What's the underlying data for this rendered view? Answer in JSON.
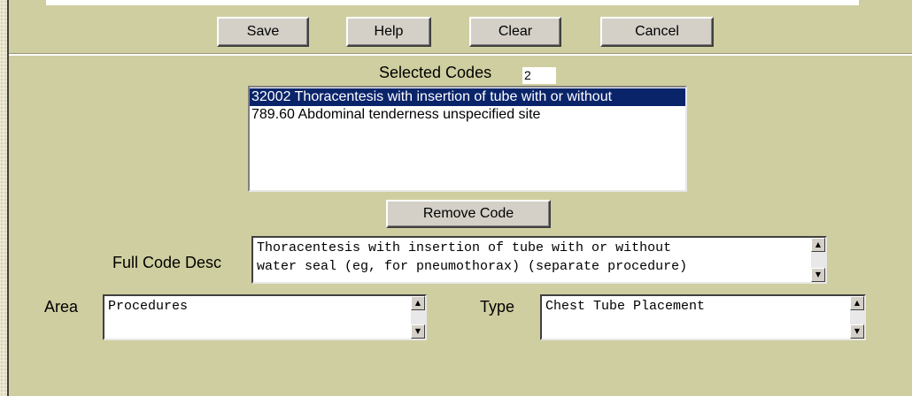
{
  "toolbar": {
    "save_label": "Save",
    "help_label": "Help",
    "clear_label": "Clear",
    "cancel_label": "Cancel"
  },
  "selected_codes": {
    "label": "Selected Codes",
    "count": "2",
    "items": [
      {
        "text": "32002 Thoracentesis with insertion of tube with or without",
        "selected": true
      },
      {
        "text": "789.60 Abdominal tenderness unspecified site",
        "selected": false
      }
    ]
  },
  "remove_code_label": "Remove Code",
  "full_code_desc": {
    "label": "Full Code Desc",
    "value": "Thoracentesis with insertion of tube with or without\nwater seal (eg, for pneumothorax) (separate procedure)"
  },
  "area": {
    "label": "Area",
    "value": "Procedures"
  },
  "type": {
    "label": "Type",
    "value": "Chest Tube Placement"
  },
  "icons": {
    "scroll_up": "▲",
    "scroll_down": "▼"
  },
  "colors": {
    "panel": "#cfcea0",
    "selection": "#0a246a",
    "button_face": "#d4d0c8"
  }
}
